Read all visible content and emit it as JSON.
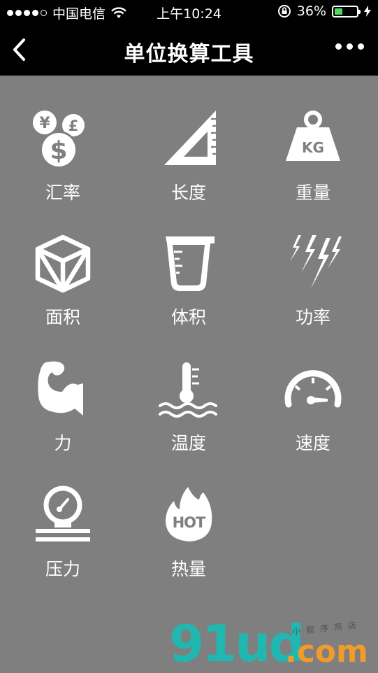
{
  "status_bar": {
    "carrier": "中国电信",
    "time": "上午10:24",
    "battery_percent": "36%",
    "battery_level": 0.36,
    "signal_bars_filled": 4,
    "signal_bars_total": 5
  },
  "nav": {
    "title": "单位换算工具",
    "back_icon": "chevron-left-icon",
    "more_icon": "more-dots-icon"
  },
  "tools": [
    {
      "label": "汇率",
      "icon": "currency-coins-icon"
    },
    {
      "label": "长度",
      "icon": "set-square-icon"
    },
    {
      "label": "重量",
      "icon": "kg-weight-icon"
    },
    {
      "label": "面积",
      "icon": "box-icon"
    },
    {
      "label": "体积",
      "icon": "measuring-cup-icon"
    },
    {
      "label": "功率",
      "icon": "lightning-icon"
    },
    {
      "label": "力",
      "icon": "bicep-icon"
    },
    {
      "label": "温度",
      "icon": "thermometer-icon"
    },
    {
      "label": "速度",
      "icon": "speedometer-icon"
    },
    {
      "label": "压力",
      "icon": "pressure-gauge-icon"
    },
    {
      "label": "热量",
      "icon": "hot-flame-icon"
    }
  ],
  "icon_text": {
    "kg": "KG",
    "hot": "HOT",
    "yen": "¥",
    "pound": "£",
    "dollar": "$"
  },
  "watermark": {
    "main": "91ud",
    "domain": ".com",
    "tagline": "小程序商店"
  },
  "colors": {
    "background": "#7f7f7f",
    "bar": "#000000",
    "battery_fill": "#4cd964",
    "watermark_main": "#1fb7b0",
    "watermark_domain": "#f39a2b"
  }
}
